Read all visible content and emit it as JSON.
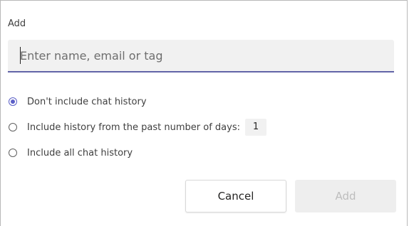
{
  "dialog": {
    "title": "Add",
    "search": {
      "placeholder": "Enter name, email or tag",
      "value": ""
    },
    "options": [
      {
        "label": "Don't include chat history",
        "checked": true
      },
      {
        "label": "Include history from the past number of days:",
        "checked": false,
        "days_value": "1"
      },
      {
        "label": "Include all chat history",
        "checked": false
      }
    ],
    "buttons": {
      "cancel": "Cancel",
      "add": "Add"
    }
  },
  "colors": {
    "accent": "#6264a7",
    "radio_selected": "#5b5fc7",
    "field_background": "#f1f1f1",
    "disabled_text": "#bdbdbd"
  }
}
